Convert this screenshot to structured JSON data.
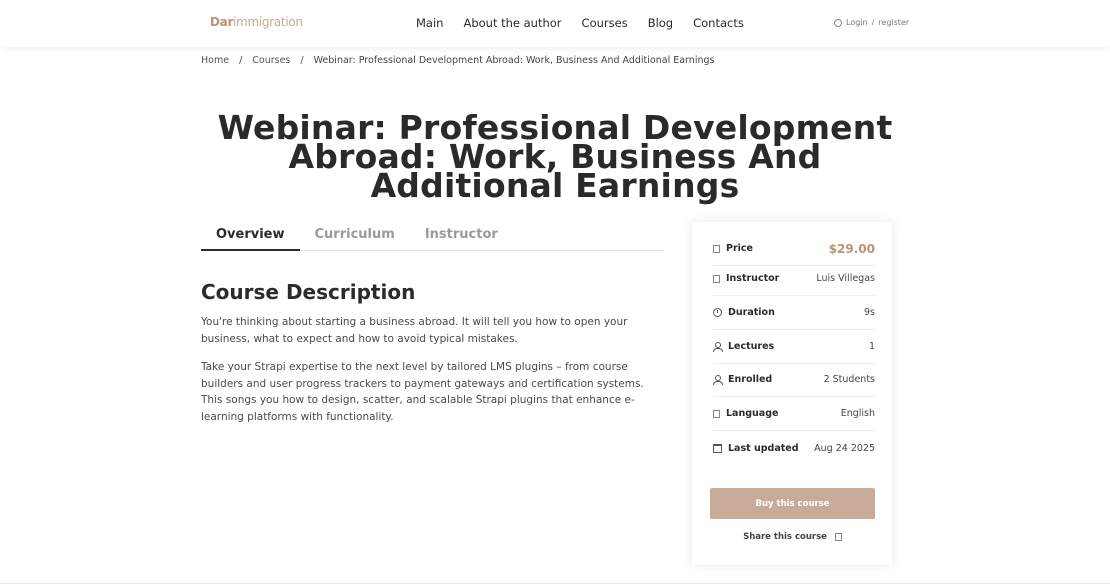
{
  "logo": {
    "left": "Dar",
    "mid": "immigration"
  },
  "nav": {
    "items": [
      "Main",
      "About the author",
      "Courses",
      "Blog",
      "Contacts"
    ]
  },
  "auth": {
    "login": "Login",
    "sep": "/",
    "register": "register"
  },
  "breadcrumb": {
    "home": "Home",
    "courses": "Courses",
    "current": "Webinar: Professional Development Abroad: Work, Business And Additional Earnings",
    "sep": "/"
  },
  "page": {
    "title": "Webinar: Professional Development Abroad: Work, Business And Additional Earnings"
  },
  "tabs": [
    "Overview",
    "Curriculum",
    "Instructor"
  ],
  "description": {
    "heading": "Course Description",
    "p1": "You're thinking about starting a business abroad. It will tell you how to open your business, what to expect and how to avoid typical mistakes.",
    "p2": "Take your Strapi expertise to the next level by tailored LMS plugins – from course builders and user progress trackers to payment gateways and certification systems. This songs you how to design, scatter, and scalable Strapi plugins that enhance e-learning platforms with functionality."
  },
  "card": {
    "price": {
      "label": "Price",
      "value": "$29.00"
    },
    "instructor": {
      "label": "Instructor",
      "value": "Luis Villegas"
    },
    "duration": {
      "label": "Duration",
      "value": "9s"
    },
    "lectures": {
      "label": "Lectures",
      "value": "1"
    },
    "enrolled": {
      "label": "Enrolled",
      "value": "2 Students"
    },
    "language": {
      "label": "Language",
      "value": "English"
    },
    "updated": {
      "label": "Last updated",
      "value": "Aug 24 2025"
    },
    "buy_label": "Buy this course",
    "share_label": "Share this course"
  },
  "colors": {
    "accent": "#b89476",
    "button": "#c7ab98"
  }
}
